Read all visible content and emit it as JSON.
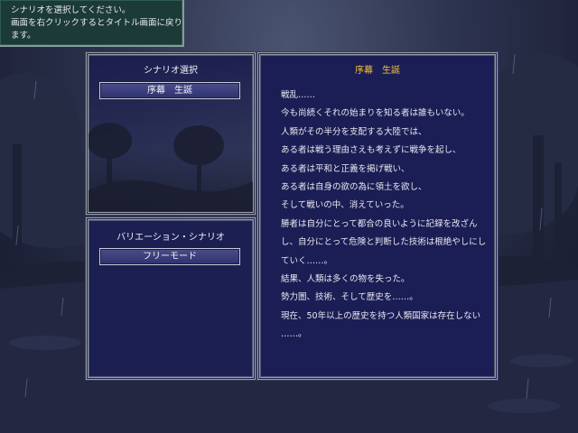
{
  "hint": {
    "line1": "シナリオを選択してください。",
    "line2": "画面を右クリックするとタイトル画面に戻ります。"
  },
  "scenario_select": {
    "title": "シナリオ選択",
    "buttons": [
      "序幕　生誕"
    ]
  },
  "variation": {
    "title": "バリエーション・シナリオ",
    "buttons": [
      "フリーモード"
    ]
  },
  "story": {
    "title": "序幕　生誕",
    "lines": [
      "戦乱……",
      "今も尚続くそれの始まりを知る者は誰もいない。",
      "人類がその半分を支配する大陸では、",
      "ある者は戦う理由さえも考えずに戦争を起し、",
      "ある者は平和と正義を掲げ戦い、",
      "ある者は自身の欲の為に領土を欲し、",
      "そして戦いの中、消えていった。",
      "勝者は自分にとって都合の良いように記録を改ざん",
      "し、自分にとって危険と判断した技術は根絶やしにし",
      "ていく……。",
      "結果、人類は多くの物を失った。",
      "勢力圏、技術、そして歴史を……。",
      "現在、50年以上の歴史を持つ人類国家は存在しない",
      "……。"
    ]
  },
  "colors": {
    "story_title": "#f0c040",
    "panel_bg": "#1b1e55",
    "hint_bg": "#1c3a38"
  }
}
